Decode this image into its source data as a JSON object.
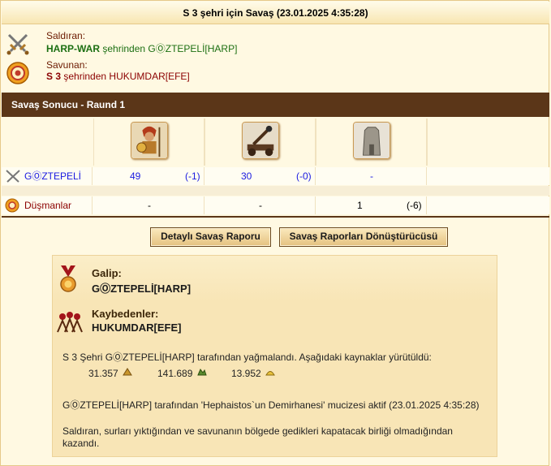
{
  "title": "S 3 şehri için Savaş (23.01.2025 4:35:28)",
  "attacker": {
    "label": "Saldıran:",
    "player": "HARP-WAR",
    "from_text": "şehrinden",
    "city": "GⓄZTEPELİ[HARP]",
    "icon": "crossed-swords-icon"
  },
  "defender": {
    "label": "Savunan:",
    "city_prefix": "S 3",
    "from_text": "şehrinden",
    "player": "HUKUMDAR[EFE]",
    "icon": "shield-target-icon"
  },
  "battle_bar": "Savaş Sonucu - Raund 1",
  "units": [
    "hoplite-unit-icon",
    "catapult-unit-icon",
    "wall-unit-icon"
  ],
  "rows": {
    "attacker": {
      "name": "GⓄZTEPELİ",
      "u1_count": "49",
      "u1_loss": "(-1)",
      "u2_count": "30",
      "u2_loss": "(-0)",
      "u3_count": "-"
    },
    "enemies": {
      "name": "Düşmanlar",
      "u1_count": "-",
      "u2_count": "-",
      "u3_count": "1",
      "u3_loss": "(-6)"
    }
  },
  "buttons": {
    "detailed": "Detaylı Savaş Raporu",
    "converter": "Savaş Raporları Dönüştürücüsü"
  },
  "summary": {
    "winner_label": "Galip:",
    "winner": "GⓄZTEPELİ[HARP]",
    "losers_label": "Kaybedenler:",
    "loser": "HUKUMDAR[EFE]",
    "plunder_text": "S 3 Şehri GⓄZTEPELİ[HARP] tarafından yağmalandı. Aşağıdaki kaynaklar yürütüldü:",
    "resources": [
      {
        "value": "31.357",
        "icon": "wood-icon"
      },
      {
        "value": "141.689",
        "icon": "marble-icon"
      },
      {
        "value": "13.952",
        "icon": "sulfur-icon"
      }
    ],
    "wonder_text": "GⓄZTEPELİ[HARP] tarafından 'Hephaistos`un Demirhanesi' mucizesi aktif (23.01.2025 4:35:28)",
    "result_text": "Saldıran, surları yıktığından ve savunanın bölgede gedikleri kapatacak birliği olmadığından kazandı."
  },
  "colors": {
    "bar_bg": "#5b3618",
    "attacker_green": "#1c6f12",
    "defender_red": "#8b0000",
    "count_blue": "#1a1ae0"
  }
}
